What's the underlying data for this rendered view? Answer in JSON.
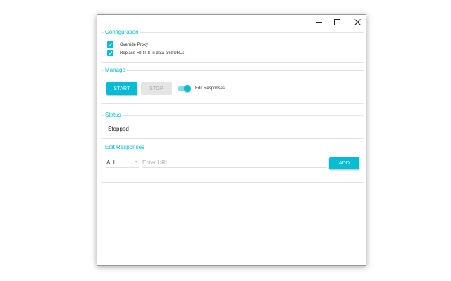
{
  "window": {
    "controls": {
      "minimize": "minimize-icon",
      "maximize": "maximize-icon",
      "close": "close-icon"
    }
  },
  "configuration": {
    "title": "Configuration",
    "options": [
      {
        "label": "Override Proxy",
        "checked": true
      },
      {
        "label": "Replace HTTPS in data and URLs",
        "checked": true
      }
    ]
  },
  "manage": {
    "title": "Manage",
    "start_label": "START",
    "stop_label": "STOP",
    "toggle_label": "Edit Responses",
    "toggle_on": true
  },
  "status": {
    "title": "Status",
    "value": "Stopped"
  },
  "edit_responses": {
    "title": "Edit Responses",
    "method_selected": "ALL",
    "url_placeholder": "Enter URL",
    "url_value": "",
    "add_label": "ADD"
  },
  "colors": {
    "accent": "#00bcd4",
    "accent_light": "#80deea",
    "disabled": "#e5e5e5"
  }
}
